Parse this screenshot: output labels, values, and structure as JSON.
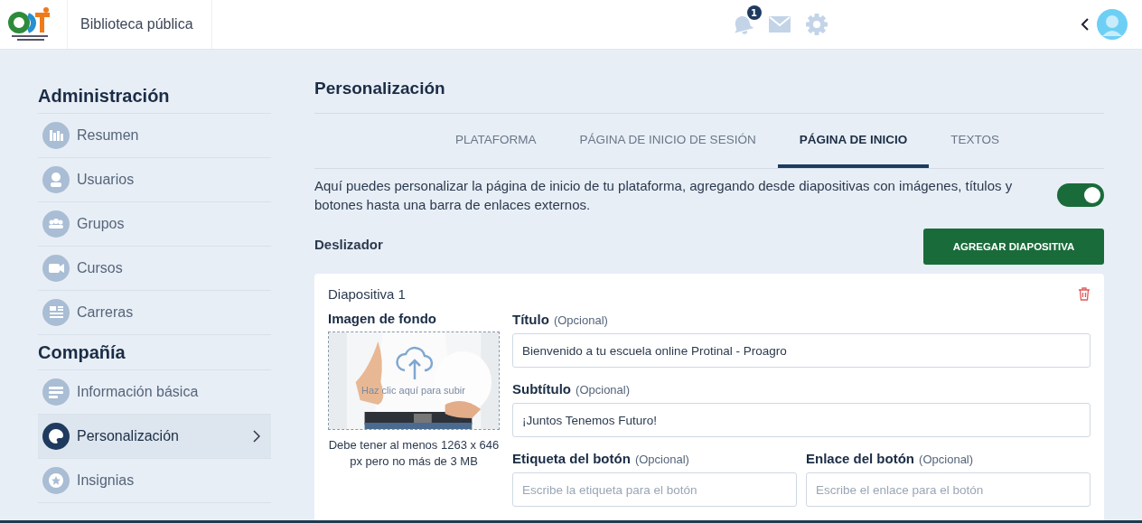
{
  "header": {
    "app_name": "Biblioteca pública",
    "notification_count": "1"
  },
  "sidebar": {
    "sections": [
      {
        "title": "Administración",
        "items": [
          {
            "label": "Resumen",
            "kind": "chart",
            "selected": false
          },
          {
            "label": "Usuarios",
            "kind": "user",
            "selected": false
          },
          {
            "label": "Grupos",
            "kind": "group",
            "selected": false
          },
          {
            "label": "Cursos",
            "kind": "video",
            "selected": false
          },
          {
            "label": "Carreras",
            "kind": "list",
            "selected": false
          }
        ]
      },
      {
        "title": "Compañía",
        "items": [
          {
            "label": "Información básica",
            "kind": "lines",
            "selected": false
          },
          {
            "label": "Personalización",
            "kind": "palette",
            "selected": true
          },
          {
            "label": "Insignias",
            "kind": "star",
            "selected": false
          }
        ]
      }
    ]
  },
  "page": {
    "title": "Personalización",
    "tabs": [
      {
        "label": "PLATAFORMA",
        "selected": false
      },
      {
        "label": "PÁGINA DE INICIO DE SESIÓN",
        "selected": false
      },
      {
        "label": "PÁGINA DE INICIO",
        "selected": true
      },
      {
        "label": "TEXTOS",
        "selected": false
      }
    ],
    "description": "Aquí puedes personalizar la página de inicio de tu plataforma, agregando desde diapositivas con imágenes, títulos y botones hasta una barra de enlaces externos.",
    "toggle": {
      "on": true
    },
    "slider_section": {
      "title": "Deslizador",
      "add_button": "AGREGAR DIAPOSITIVA"
    },
    "slide": {
      "title": "Diapositiva 1",
      "image_label": "Imagen de fondo",
      "upload_hint": "Haz clic aquí para subir",
      "image_note": "Debe tener al menos 1263 x 646 px pero no más de 3 MB",
      "fields": [
        {
          "label": "Título",
          "hint": "(Opcional)",
          "value": "Bienvenido a tu escuela online Protinal - Proagro"
        },
        {
          "label": "Subtítulo",
          "hint": "(Opcional)",
          "value": "¡Juntos Tenemos Futuro!"
        }
      ],
      "pair_fields": [
        {
          "label": "Etiqueta del botón",
          "hint": "(Opcional)",
          "placeholder": "Escribe la etiqueta para el botón"
        },
        {
          "label": "Enlace del botón",
          "hint": "(Opcional)",
          "placeholder": "Escribe el enlace para el botón"
        }
      ]
    }
  }
}
